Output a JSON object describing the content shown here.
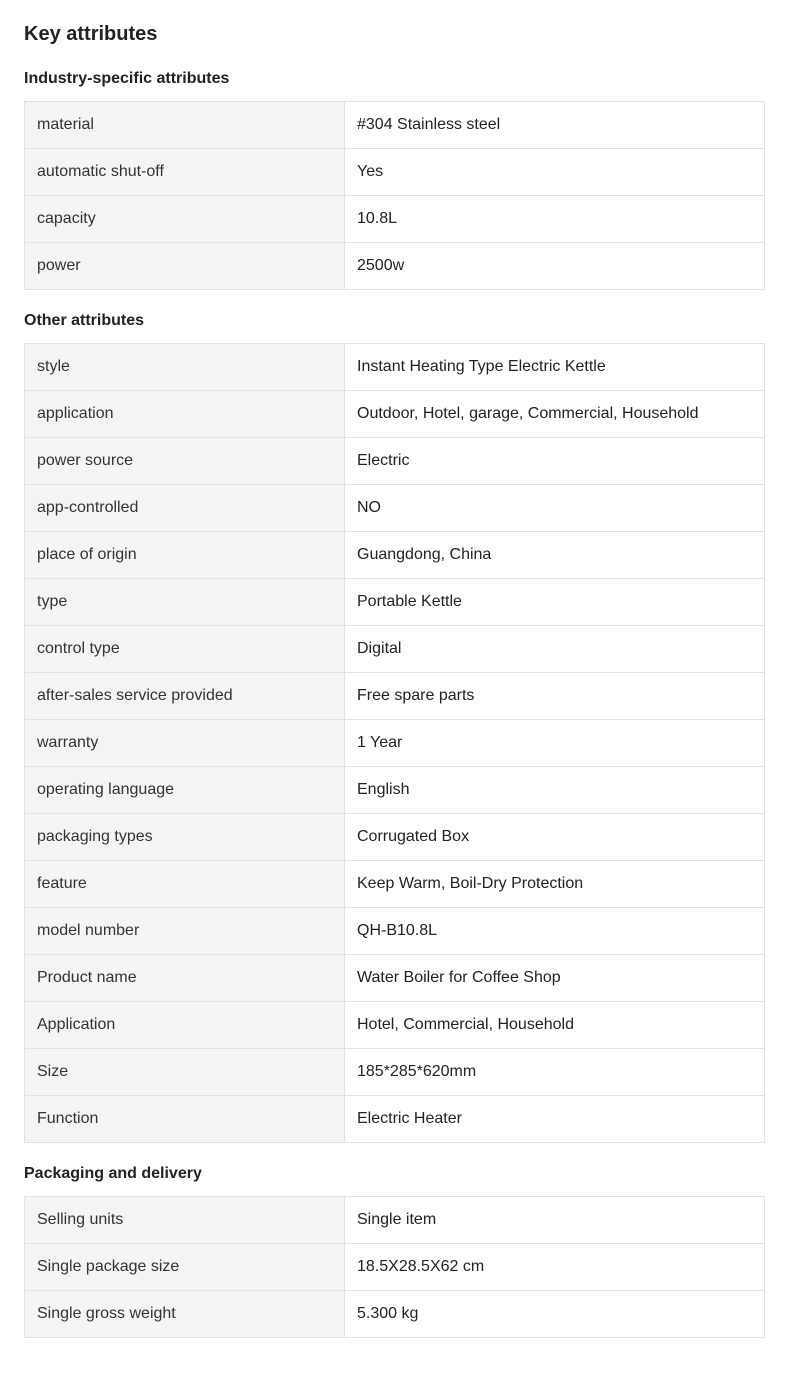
{
  "page_title": "Key attributes",
  "sections": [
    {
      "title": "Industry-specific attributes",
      "rows": [
        {
          "key": "material",
          "value": "#304 Stainless steel"
        },
        {
          "key": "automatic shut-off",
          "value": "Yes"
        },
        {
          "key": "capacity",
          "value": "10.8L"
        },
        {
          "key": "power",
          "value": "2500w"
        }
      ]
    },
    {
      "title": "Other attributes",
      "rows": [
        {
          "key": "style",
          "value": "Instant Heating Type Electric Kettle"
        },
        {
          "key": "application",
          "value": "Outdoor, Hotel, garage, Commercial, Household"
        },
        {
          "key": "power source",
          "value": "Electric"
        },
        {
          "key": "app-controlled",
          "value": "NO"
        },
        {
          "key": "place of origin",
          "value": "Guangdong, China"
        },
        {
          "key": "type",
          "value": "Portable Kettle"
        },
        {
          "key": "control type",
          "value": "Digital"
        },
        {
          "key": "after-sales service provided",
          "value": "Free spare parts"
        },
        {
          "key": "warranty",
          "value": "1 Year"
        },
        {
          "key": "operating language",
          "value": "English"
        },
        {
          "key": "packaging types",
          "value": "Corrugated Box"
        },
        {
          "key": "feature",
          "value": "Keep Warm, Boil-Dry Protection"
        },
        {
          "key": "model number",
          "value": "QH-B10.8L"
        },
        {
          "key": "Product name",
          "value": "Water Boiler for Coffee Shop"
        },
        {
          "key": "Application",
          "value": "Hotel, Commercial, Household"
        },
        {
          "key": "Size",
          "value": "185*285*620mm"
        },
        {
          "key": "Function",
          "value": "Electric Heater"
        }
      ]
    },
    {
      "title": "Packaging and delivery",
      "rows": [
        {
          "key": "Selling units",
          "value": "Single item"
        },
        {
          "key": "Single package size",
          "value": "18.5X28.5X62 cm"
        },
        {
          "key": "Single gross weight",
          "value": "5.300 kg"
        }
      ]
    }
  ]
}
